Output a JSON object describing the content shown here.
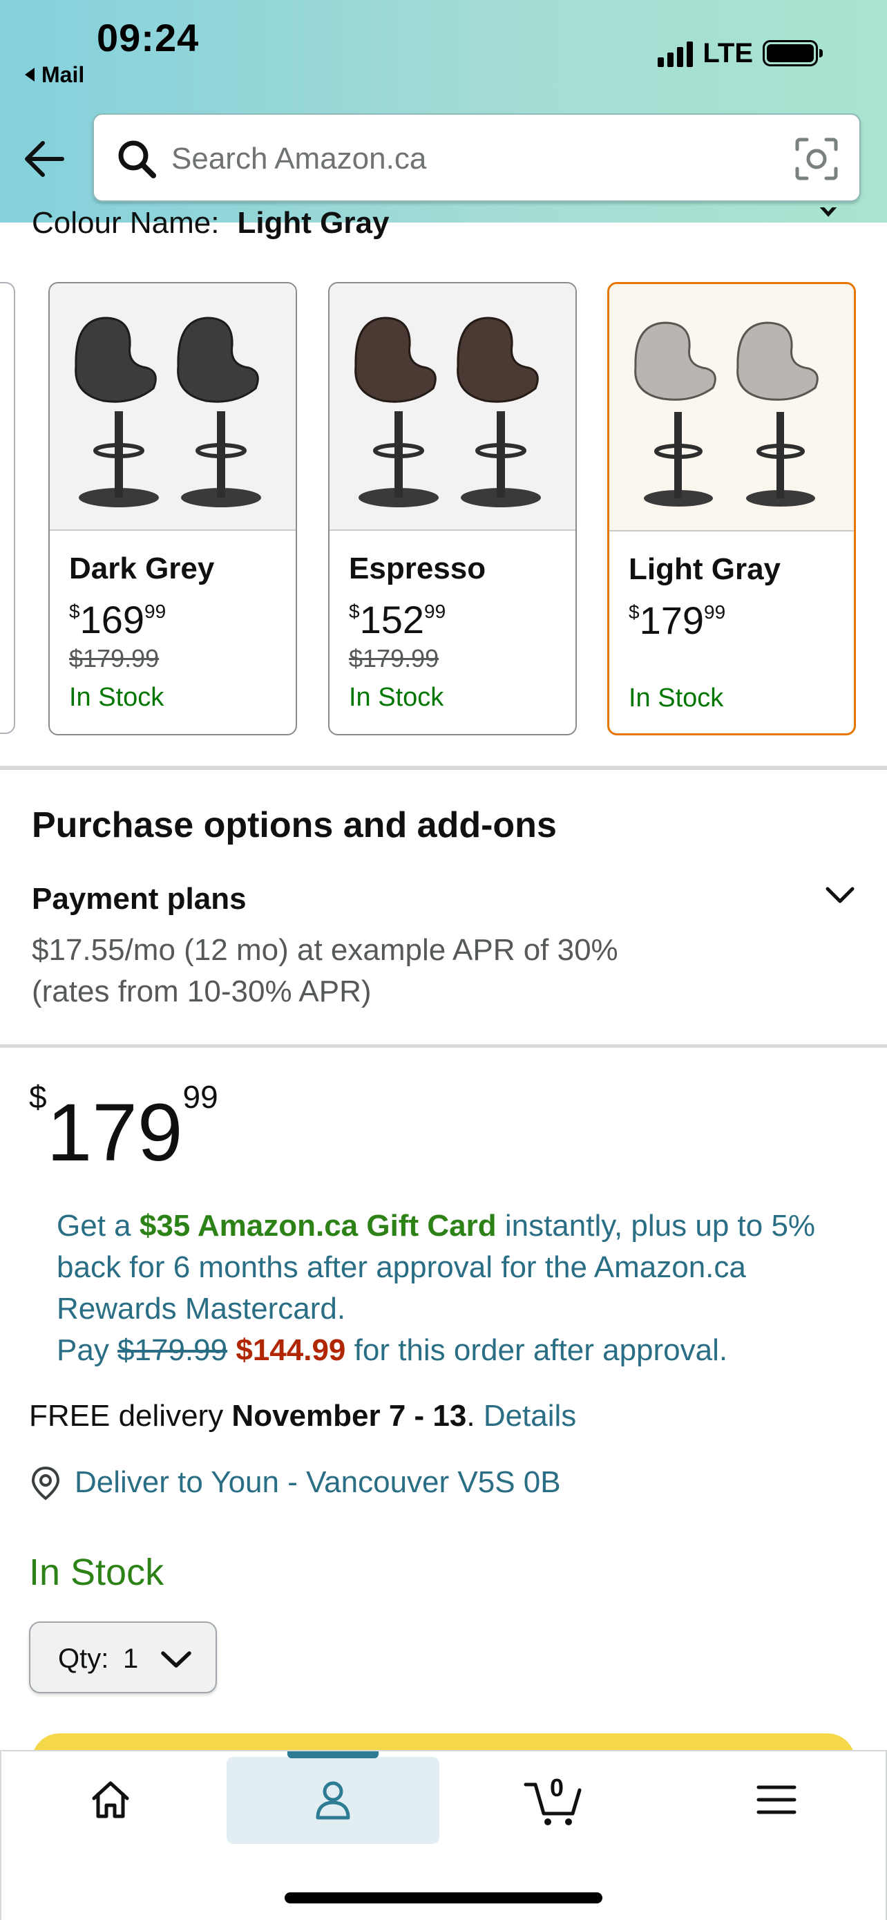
{
  "status_bar": {
    "time": "09:24",
    "back_app": "Mail",
    "network": "LTE"
  },
  "search": {
    "placeholder": "Search Amazon.ca"
  },
  "colour": {
    "label": "Colour Name:",
    "selected": "Light Gray"
  },
  "swatches": [
    {
      "name": "Dark Grey",
      "currency": "$",
      "whole": "169",
      "fraction": "99",
      "was": "$179.99",
      "stock": "In Stock",
      "seat_color": "#3c3c3c"
    },
    {
      "name": "Espresso",
      "currency": "$",
      "whole": "152",
      "fraction": "99",
      "was": "$179.99",
      "stock": "In Stock",
      "seat_color": "#4a3a33"
    },
    {
      "name": "Light Gray",
      "currency": "$",
      "whole": "179",
      "fraction": "99",
      "was": "",
      "stock": "In Stock",
      "seat_color": "#b9b6b1"
    }
  ],
  "purchase_options": {
    "title": "Purchase options and add-ons",
    "payment_plans_title": "Payment plans",
    "line1": "$17.55/mo (12 mo) at example APR of 30%",
    "line2": "(rates from 10-30% APR)"
  },
  "price": {
    "currency": "$",
    "whole": "179",
    "fraction": "99"
  },
  "promo": {
    "p1": "Get a ",
    "gift_card": "$35 Amazon.ca Gift Card",
    "p2": " instantly, plus up to 5% back for 6 months after approval for the Amazon.ca Rewards Mastercard.",
    "pay": "Pay ",
    "old_price": "$179.99",
    "new_price": "$144.99",
    "p3": " for this order after approval."
  },
  "delivery": {
    "prefix": "FREE delivery ",
    "dates": "November 7 - 13",
    "dot": ". ",
    "details_link": "Details"
  },
  "deliver_to": "Deliver to Youn - Vancouver V5S 0B",
  "stock_status": "In Stock",
  "quantity": {
    "label": "Qty:",
    "value": "1"
  },
  "bottom_nav": {
    "cart_count": "0"
  },
  "colors": {
    "accent": "#e77600",
    "link": "#2a6e85",
    "in_stock": "#007600",
    "deal_price": "#b12704",
    "header_gradient_start": "#84d0dc",
    "header_gradient_end": "#a9e4d0"
  }
}
